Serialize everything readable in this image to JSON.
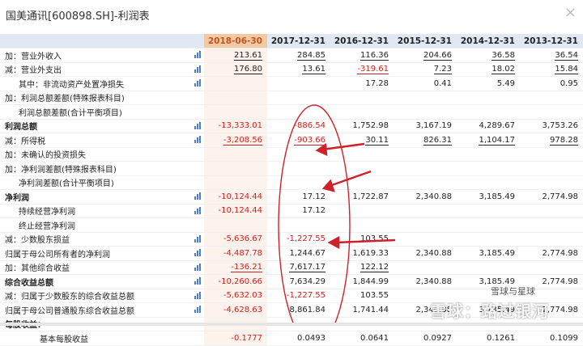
{
  "window": {
    "title": "国美通讯[600898.SH]-利润表",
    "close_glyph": "×"
  },
  "header": {
    "columns": [
      "2018-06-30",
      "2017-12-31",
      "2016-12-31",
      "2015-12-31",
      "2014-12-31",
      "2013-12-31"
    ]
  },
  "colors": {
    "highlight_header": "#f1c9a3",
    "header_bg": "#dfe8f3",
    "negative": "#d32020",
    "annotation": "#d0202a"
  },
  "rows": [
    {
      "label": "加：营业外收入",
      "level": 1,
      "icon": true,
      "values": [
        "213.61",
        "284.85",
        "116.36",
        "204.66",
        "36.58",
        "36.54"
      ],
      "neg": [
        false,
        false,
        false,
        false,
        false,
        false
      ],
      "ul": [
        true,
        true,
        true,
        true,
        true,
        true
      ]
    },
    {
      "label": "减：营业外支出",
      "level": 1,
      "icon": true,
      "values": [
        "176.80",
        "13.61",
        "-319.61",
        "7.23",
        "18.02",
        "15.84"
      ],
      "neg": [
        false,
        false,
        true,
        false,
        false,
        false
      ],
      "ul": [
        true,
        true,
        true,
        true,
        true,
        true
      ]
    },
    {
      "label": "其中：非流动资产处置净损失",
      "level": 2,
      "icon": true,
      "values": [
        "",
        "",
        "17.28",
        "0.41",
        "5.49",
        "0.95"
      ],
      "neg": [
        false,
        false,
        false,
        false,
        false,
        false
      ],
      "ul": [
        false,
        false,
        false,
        false,
        false,
        false
      ]
    },
    {
      "label": "加：利润总额差额(特殊报表科目)",
      "level": 1,
      "icon": false,
      "values": [
        "",
        "",
        "",
        "",
        "",
        ""
      ],
      "neg": [
        false,
        false,
        false,
        false,
        false,
        false
      ],
      "ul": [
        false,
        false,
        false,
        false,
        false,
        false
      ]
    },
    {
      "label": "利润总额差额(合计平衡项目)",
      "level": 2,
      "icon": false,
      "values": [
        "",
        "",
        "",
        "",
        "",
        ""
      ],
      "neg": [
        false,
        false,
        false,
        false,
        false,
        false
      ],
      "ul": [
        false,
        false,
        false,
        false,
        false,
        false
      ]
    },
    {
      "label": "利润总额",
      "level": 0,
      "icon": true,
      "values": [
        "-13,333.01",
        "-886.54",
        "1,752.98",
        "3,167.19",
        "4,289.67",
        "3,753.26"
      ],
      "neg": [
        true,
        true,
        false,
        false,
        false,
        false
      ],
      "ul": [
        false,
        false,
        false,
        false,
        false,
        false
      ]
    },
    {
      "label": "减：所得税",
      "level": 1,
      "icon": true,
      "values": [
        "-3,208.56",
        "-903.66",
        "30.11",
        "826.31",
        "1,104.17",
        "978.28"
      ],
      "neg": [
        true,
        true,
        false,
        false,
        false,
        false
      ],
      "ul": [
        true,
        true,
        true,
        true,
        true,
        true
      ]
    },
    {
      "label": "加：未确认的投资损失",
      "level": 1,
      "icon": false,
      "values": [
        "",
        "",
        "",
        "",
        "",
        ""
      ],
      "neg": [
        false,
        false,
        false,
        false,
        false,
        false
      ],
      "ul": [
        false,
        false,
        false,
        false,
        false,
        false
      ]
    },
    {
      "label": "加：净利润差额(特殊报表科目)",
      "level": 1,
      "icon": false,
      "values": [
        "",
        "",
        "",
        "",
        "",
        ""
      ],
      "neg": [
        false,
        false,
        false,
        false,
        false,
        false
      ],
      "ul": [
        false,
        false,
        false,
        false,
        false,
        false
      ]
    },
    {
      "label": "净利润差额(合计平衡项目)",
      "level": 2,
      "icon": false,
      "values": [
        "",
        "",
        "",
        "",
        "",
        ""
      ],
      "neg": [
        false,
        false,
        false,
        false,
        false,
        false
      ],
      "ul": [
        false,
        false,
        false,
        false,
        false,
        false
      ]
    },
    {
      "label": "净利润",
      "level": 0,
      "icon": true,
      "values": [
        "-10,124.44",
        "17.12",
        "1,722.87",
        "2,340.88",
        "3,185.49",
        "2,774.98"
      ],
      "neg": [
        true,
        false,
        false,
        false,
        false,
        false
      ],
      "ul": [
        false,
        false,
        false,
        false,
        false,
        false
      ]
    },
    {
      "label": "持续经营净利润",
      "level": 2,
      "icon": true,
      "values": [
        "-10,124.44",
        "17.12",
        "",
        "",
        "",
        ""
      ],
      "neg": [
        true,
        false,
        false,
        false,
        false,
        false
      ],
      "ul": [
        false,
        false,
        false,
        false,
        false,
        false
      ]
    },
    {
      "label": "终止经营净利润",
      "level": 2,
      "icon": false,
      "values": [
        "",
        "",
        "",
        "",
        "",
        ""
      ],
      "neg": [
        false,
        false,
        false,
        false,
        false,
        false
      ],
      "ul": [
        false,
        false,
        false,
        false,
        false,
        false
      ]
    },
    {
      "label": "减：少数股东损益",
      "level": 1,
      "icon": true,
      "values": [
        "-5,636.67",
        "-1,227.55",
        "103.55",
        "",
        "",
        ""
      ],
      "neg": [
        true,
        true,
        false,
        false,
        false,
        false
      ],
      "ul": [
        false,
        false,
        false,
        false,
        false,
        false
      ]
    },
    {
      "label": "归属于母公司所有者的净利润",
      "level": 1,
      "icon": true,
      "values": [
        "-4,487.78",
        "1,244.67",
        "1,619.33",
        "2,340.88",
        "3,185.49",
        "2,774.98"
      ],
      "neg": [
        true,
        false,
        false,
        false,
        false,
        false
      ],
      "ul": [
        false,
        false,
        false,
        false,
        false,
        false
      ]
    },
    {
      "label": "加：其他综合收益",
      "level": 1,
      "icon": true,
      "values": [
        "-136.21",
        "7,617.17",
        "122.12",
        "",
        "",
        ""
      ],
      "neg": [
        true,
        false,
        false,
        false,
        false,
        false
      ],
      "ul": [
        true,
        true,
        true,
        false,
        false,
        false
      ]
    },
    {
      "label": "综合收益总额",
      "level": 0,
      "icon": true,
      "values": [
        "-10,260.66",
        "7,634.29",
        "1,844.99",
        "2,340.88",
        "3,185.49",
        "2,774.98"
      ],
      "neg": [
        true,
        false,
        false,
        false,
        false,
        false
      ],
      "ul": [
        false,
        false,
        false,
        false,
        false,
        false
      ]
    },
    {
      "label": "减：归属于少数股东的综合收益总额",
      "level": 1,
      "icon": true,
      "values": [
        "-5,632.03",
        "-1,227.55",
        "103.55",
        "",
        "",
        ""
      ],
      "neg": [
        true,
        true,
        false,
        false,
        false,
        false
      ],
      "ul": [
        false,
        false,
        false,
        false,
        false,
        false
      ]
    },
    {
      "label": "归属于母公司普通股东综合收益总额",
      "level": 1,
      "icon": true,
      "values": [
        "-4,628.63",
        "8,861.84",
        "1,741.44",
        "2,340.88",
        "3,185.49",
        "2,774.98"
      ],
      "neg": [
        true,
        false,
        false,
        false,
        false,
        false
      ],
      "ul": [
        false,
        false,
        false,
        false,
        false,
        false
      ]
    },
    {
      "label": "每股收益：",
      "level": 0,
      "icon": false,
      "values": [
        "",
        "",
        "",
        "",
        "",
        ""
      ],
      "neg": [
        false,
        false,
        false,
        false,
        false,
        false
      ],
      "ul": [
        false,
        false,
        false,
        false,
        false,
        false
      ]
    },
    {
      "label": "基本每股收益",
      "level": 3,
      "icon": false,
      "values": [
        "-0.1777",
        "0.0493",
        "0.0641",
        "0.0927",
        "0.1261",
        "0.1099"
      ],
      "neg": [
        true,
        false,
        false,
        false,
        false,
        false
      ],
      "ul": [
        false,
        false,
        false,
        false,
        false,
        false
      ]
    }
  ],
  "watermark": {
    "text": "雪球：路过银河",
    "source": "雪球与星球"
  }
}
